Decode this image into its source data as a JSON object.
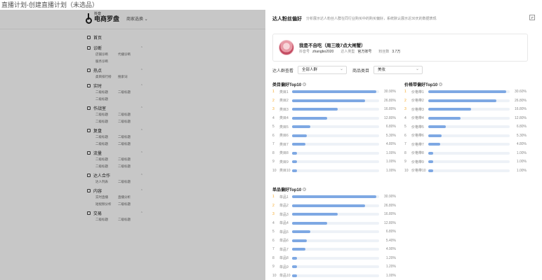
{
  "window": {
    "title": "直播计划-创建直播计划（未选品）"
  },
  "background": {
    "logo_small": "抖音",
    "logo_big": "电商罗盘",
    "shop_select": "商家选换 ⌄",
    "nav": [
      {
        "label": "首页",
        "sub": []
      },
      {
        "label": "诊断",
        "sub": [
          "店铺诊断",
          "代播诊断",
          "服务诊断"
        ]
      },
      {
        "label": "热点",
        "sub": [
          "类目排行榜",
          "搜索词"
        ]
      },
      {
        "label": "实时",
        "sub": [
          "二级标题",
          "二级标题",
          "二级标题"
        ]
      },
      {
        "label": "作战室",
        "sub": [
          "二级标题",
          "二级标题",
          "二级标题",
          "二级标题"
        ]
      },
      {
        "label": "复盘",
        "sub": [
          "二级标题",
          "二级标题",
          "二级标题",
          "二级标题"
        ]
      },
      {
        "label": "流量",
        "sub": [
          "二级标题",
          "二级标题",
          "二级标题",
          "二级标题"
        ]
      },
      {
        "label": "达人合作",
        "sub": [
          "达人列表",
          "二级标题"
        ]
      },
      {
        "label": "内容",
        "sub": [
          "实时直播",
          "直播分析",
          "短视频分析",
          "二级标题"
        ]
      },
      {
        "label": "交易",
        "sub": [
          "二级标题",
          "二级标题"
        ]
      }
    ]
  },
  "drawer": {
    "title": "达人粉丝偏好",
    "description": "分析展示达人粉丝人群在同行业购买中的购买偏好，系统默认展示近30天的数据表现",
    "profile": {
      "name": "我是不自吃（周三晚7点大闸蟹）",
      "id_label": "抖音号",
      "id_value": "zhangbo2020",
      "type_label": "达人类型",
      "type_value": "官方账号",
      "fans_label": "粉丝数",
      "fans_value": "3.7万"
    },
    "filters": {
      "crowd_label": "达人群查看",
      "crowd_value": "全部人群",
      "category_label": "商品类目",
      "category_value": "美妆"
    }
  },
  "rankings": [
    {
      "title": "类目偏好Top10",
      "rows": [
        {
          "rank": "1",
          "label": "类目1",
          "value": 30.9,
          "display": "30.90%"
        },
        {
          "rank": "2",
          "label": "类目2",
          "value": 26.8,
          "display": "26.80%"
        },
        {
          "rank": "3",
          "label": "类目3",
          "value": 16.8,
          "display": "16.80%"
        },
        {
          "rank": "4",
          "label": "类目4",
          "value": 12.8,
          "display": "12.80%"
        },
        {
          "rank": "5",
          "label": "类目5",
          "value": 6.8,
          "display": "6.80%"
        },
        {
          "rank": "6",
          "label": "类目6",
          "value": 5.3,
          "display": "5.30%"
        },
        {
          "rank": "7",
          "label": "类目7",
          "value": 4.8,
          "display": "4.80%"
        },
        {
          "rank": "8",
          "label": "类目8",
          "value": 1.0,
          "display": "1.00%"
        },
        {
          "rank": "9",
          "label": "类目9",
          "value": 1.0,
          "display": "1.00%"
        },
        {
          "rank": "10",
          "label": "类目10",
          "value": 1.0,
          "display": "1.00%"
        }
      ]
    },
    {
      "title": "价格带偏好Top10",
      "rows": [
        {
          "rank": "1",
          "label": "价格带1",
          "value": 30.6,
          "display": "30.60%"
        },
        {
          "rank": "2",
          "label": "价格带2",
          "value": 26.8,
          "display": "26.80%"
        },
        {
          "rank": "3",
          "label": "价格带3",
          "value": 16.8,
          "display": "16.80%"
        },
        {
          "rank": "4",
          "label": "价格带4",
          "value": 12.8,
          "display": "12.80%"
        },
        {
          "rank": "5",
          "label": "价格带5",
          "value": 6.8,
          "display": "6.80%"
        },
        {
          "rank": "6",
          "label": "价格带6",
          "value": 5.3,
          "display": "5.30%"
        },
        {
          "rank": "7",
          "label": "价格带7",
          "value": 4.8,
          "display": "4.80%"
        },
        {
          "rank": "8",
          "label": "价格带8",
          "value": 1.0,
          "display": "1.00%"
        },
        {
          "rank": "9",
          "label": "价格带9",
          "value": 1.0,
          "display": "1.00%"
        },
        {
          "rank": "10",
          "label": "价格带10",
          "value": 1.0,
          "display": "1.00%"
        }
      ]
    },
    {
      "title": "单品偏好Top10",
      "rows": [
        {
          "rank": "1",
          "label": "单品1",
          "value": 30.9,
          "display": "30.90%"
        },
        {
          "rank": "2",
          "label": "单品2",
          "value": 26.8,
          "display": "26.80%"
        },
        {
          "rank": "3",
          "label": "单品3",
          "value": 16.8,
          "display": "16.80%"
        },
        {
          "rank": "4",
          "label": "单品4",
          "value": 12.8,
          "display": "12.80%"
        },
        {
          "rank": "5",
          "label": "单品5",
          "value": 6.8,
          "display": "6.80%"
        },
        {
          "rank": "6",
          "label": "单品6",
          "value": 5.4,
          "display": "5.40%"
        },
        {
          "rank": "7",
          "label": "单品7",
          "value": 4.9,
          "display": "4.90%"
        },
        {
          "rank": "8",
          "label": "单品8",
          "value": 1.2,
          "display": "1.20%"
        },
        {
          "rank": "9",
          "label": "单品9",
          "value": 1.2,
          "display": "1.20%"
        },
        {
          "rank": "10",
          "label": "单品10",
          "value": 1.0,
          "display": "1.00%"
        }
      ]
    }
  ],
  "colors": {
    "bar": "#7ea8e3",
    "track": "#eef2f7",
    "top_rank": "#f5a623"
  }
}
